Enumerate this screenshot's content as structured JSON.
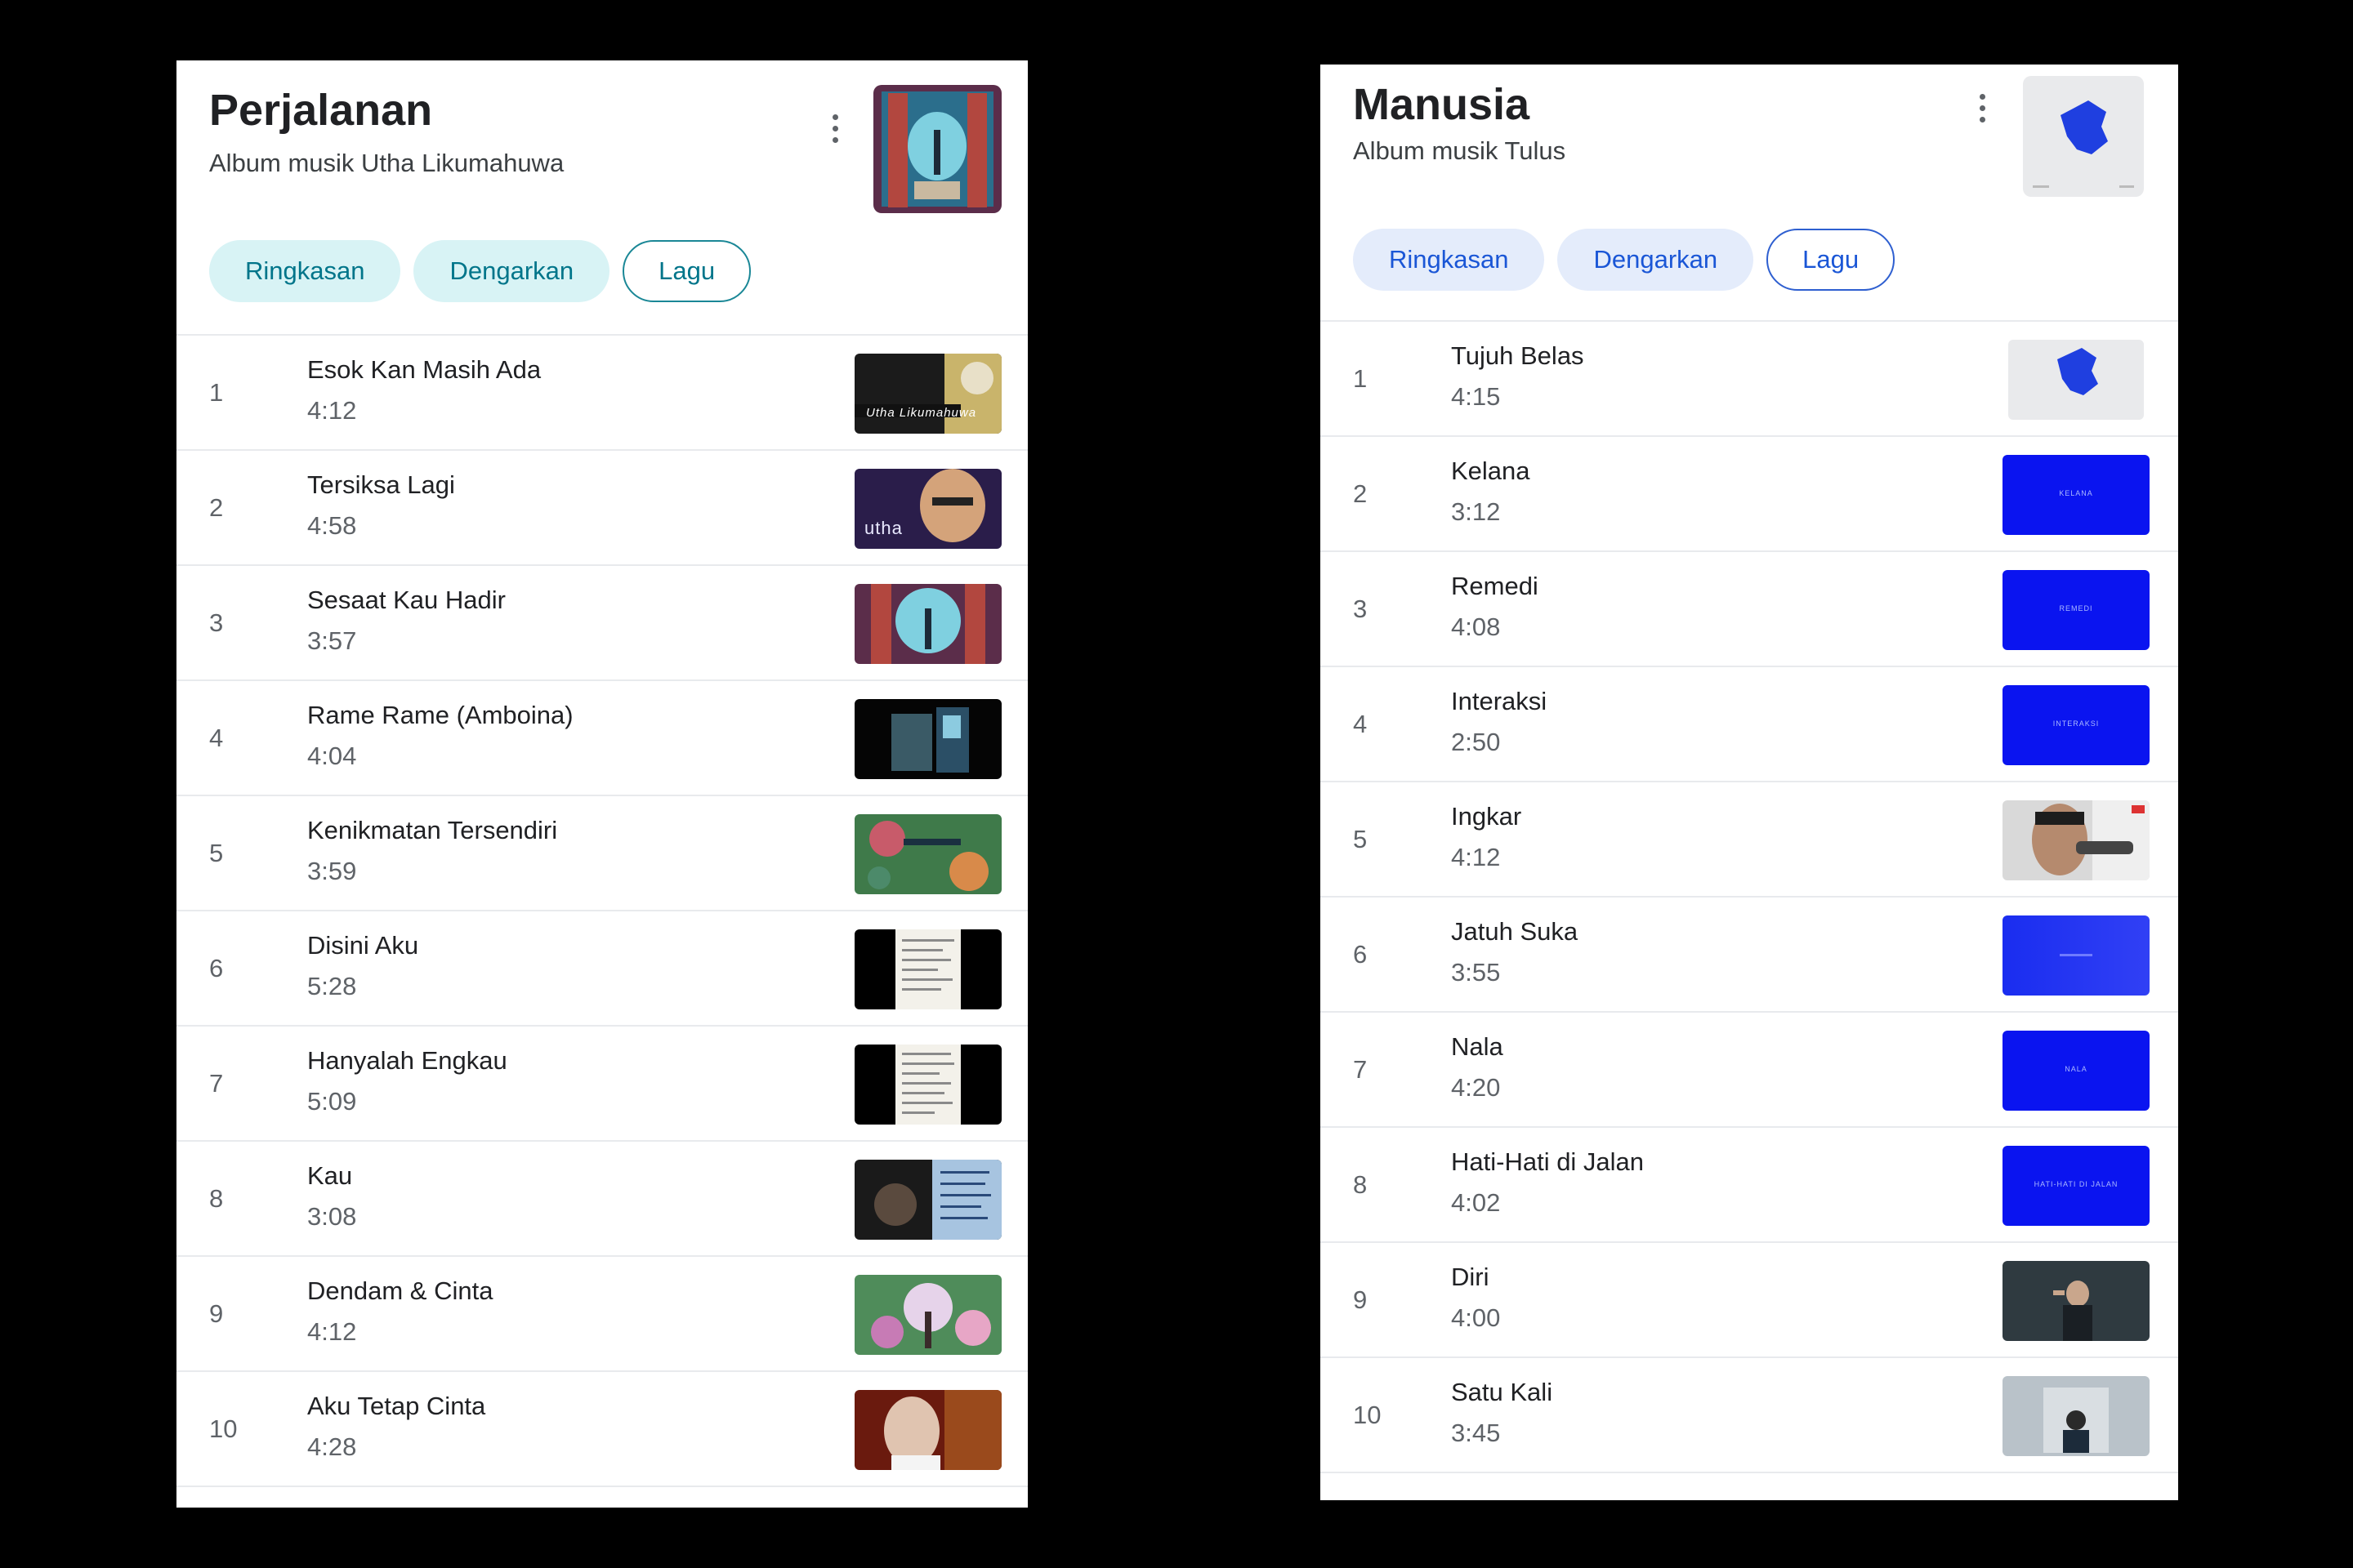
{
  "left": {
    "title": "Perjalanan",
    "subtitle": "Album musik Utha Likumahuwa",
    "chips": [
      "Ringkasan",
      "Dengarkan",
      "Lagu"
    ],
    "active_chip": "Lagu",
    "accent": "#00758a",
    "tracks": [
      {
        "num": "1",
        "name": "Esok Kan Masih Ada",
        "dur": "4:12",
        "thumb": "Utha Likumahuwa"
      },
      {
        "num": "2",
        "name": "Tersiksa Lagi",
        "dur": "4:58",
        "thumb": "utha"
      },
      {
        "num": "3",
        "name": "Sesaat Kau Hadir",
        "dur": "3:57"
      },
      {
        "num": "4",
        "name": "Rame Rame (Amboina)",
        "dur": "4:04"
      },
      {
        "num": "5",
        "name": "Kenikmatan Tersendiri",
        "dur": "3:59"
      },
      {
        "num": "6",
        "name": "Disini Aku",
        "dur": "5:28"
      },
      {
        "num": "7",
        "name": "Hanyalah Engkau",
        "dur": "5:09"
      },
      {
        "num": "8",
        "name": "Kau",
        "dur": "3:08"
      },
      {
        "num": "9",
        "name": "Dendam & Cinta",
        "dur": "4:12"
      },
      {
        "num": "10",
        "name": "Aku Tetap Cinta",
        "dur": "4:28"
      }
    ]
  },
  "right": {
    "title": "Manusia",
    "subtitle": "Album musik Tulus",
    "chips": [
      "Ringkasan",
      "Dengarkan",
      "Lagu"
    ],
    "active_chip": "Lagu",
    "accent": "#1a56d6",
    "tracks": [
      {
        "num": "1",
        "name": "Tujuh Belas",
        "dur": "4:15"
      },
      {
        "num": "2",
        "name": "Kelana",
        "dur": "3:12",
        "thumb": "KELANA"
      },
      {
        "num": "3",
        "name": "Remedi",
        "dur": "4:08",
        "thumb": "REMEDI"
      },
      {
        "num": "4",
        "name": "Interaksi",
        "dur": "2:50",
        "thumb": "INTERAKSI"
      },
      {
        "num": "5",
        "name": "Ingkar",
        "dur": "4:12"
      },
      {
        "num": "6",
        "name": "Jatuh Suka",
        "dur": "3:55"
      },
      {
        "num": "7",
        "name": "Nala",
        "dur": "4:20",
        "thumb": "NALA"
      },
      {
        "num": "8",
        "name": "Hati-Hati di Jalan",
        "dur": "4:02",
        "thumb": "HATI-HATI DI JALAN"
      },
      {
        "num": "9",
        "name": "Diri",
        "dur": "4:00"
      },
      {
        "num": "10",
        "name": "Satu Kali",
        "dur": "3:45"
      }
    ]
  }
}
